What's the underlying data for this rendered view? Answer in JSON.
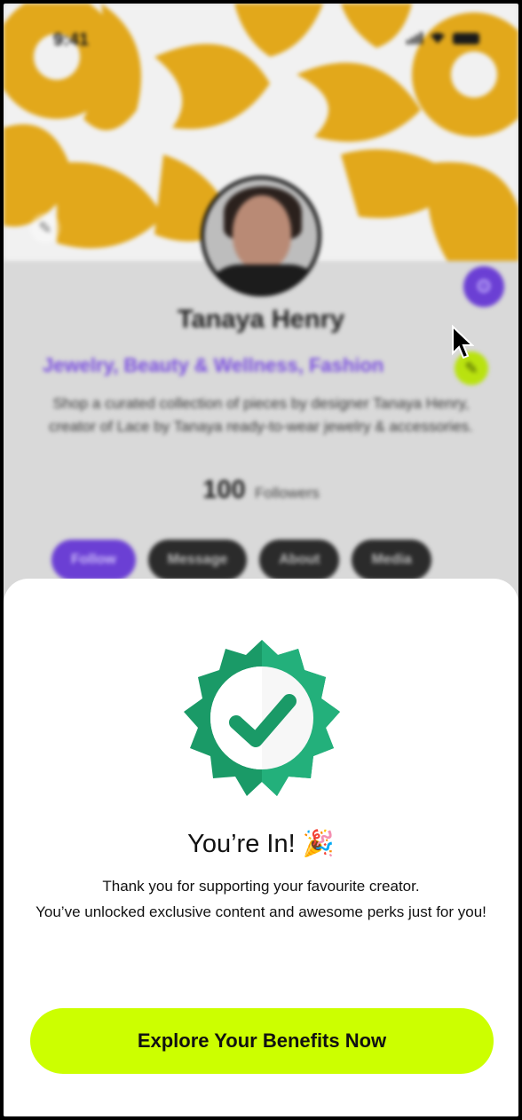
{
  "status_bar": {
    "time": "9:41"
  },
  "profile": {
    "name": "Tanaya Henry",
    "categories": "Jewelry, Beauty & Wellness, Fashion",
    "bio": "Shop a curated collection of pieces by designer Tanaya Henry, creator of Lace by Tanaya ready-to-wear jewelry & accessories.",
    "followers_count": "100",
    "followers_label": "Followers",
    "actions": [
      "Follow",
      "Message",
      "About",
      "Media"
    ]
  },
  "icons": {
    "cover_edit": "pencil-icon",
    "settings": "gear-icon",
    "category_edit": "pencil-icon",
    "success": "check-badge-icon",
    "celebration": "party-popper-icon"
  },
  "colors": {
    "accent": "#6b3fd4",
    "cta": "#ccff00",
    "cover": "#e2a81b",
    "badge": "#1a9a67"
  },
  "sheet": {
    "title": "You’re In!",
    "title_emoji": "🎉",
    "message_line1": "Thank you for supporting your favourite creator.",
    "message_line2": "You’ve unlocked exclusive content and awesome perks just for you!",
    "cta_label": "Explore Your Benefits Now"
  }
}
